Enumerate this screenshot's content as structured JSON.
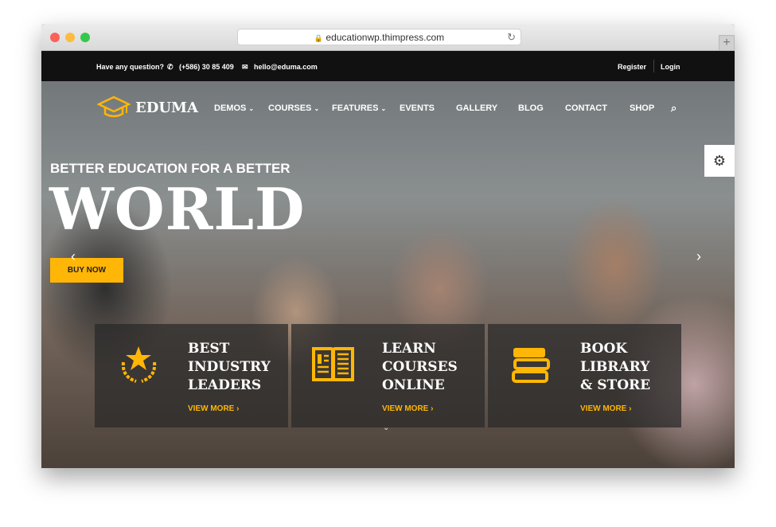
{
  "browser": {
    "url": "educationwp.thimpress.com"
  },
  "topbar": {
    "question": "Have any question?",
    "phone": "(+586) 30 85 409",
    "email": "hello@eduma.com",
    "register": "Register",
    "login": "Login"
  },
  "logo": {
    "text": "EDUMA"
  },
  "nav": [
    {
      "label": "DEMOS",
      "dropdown": true
    },
    {
      "label": "COURSES",
      "dropdown": true
    },
    {
      "label": "FEATURES",
      "dropdown": true
    },
    {
      "label": "EVENTS"
    },
    {
      "label": "GALLERY"
    },
    {
      "label": "BLOG"
    },
    {
      "label": "CONTACT"
    },
    {
      "label": "SHOP"
    }
  ],
  "hero": {
    "subtitle": "BETTER EDUCATION FOR A BETTER",
    "title": "WORLD",
    "button": "BUY NOW"
  },
  "features": [
    {
      "l1": "BEST",
      "l2": "INDUSTRY",
      "l3": "LEADERS",
      "link": "VIEW MORE",
      "icon": "award-star-icon"
    },
    {
      "l1": "LEARN",
      "l2": "COURSES",
      "l3": "ONLINE",
      "link": "VIEW MORE",
      "icon": "open-book-icon"
    },
    {
      "l1": "BOOK",
      "l2": "LIBRARY",
      "l3": "& STORE",
      "link": "VIEW MORE",
      "icon": "book-stack-icon"
    }
  ],
  "colors": {
    "accent": "#ffb606",
    "topbar": "#111111"
  }
}
